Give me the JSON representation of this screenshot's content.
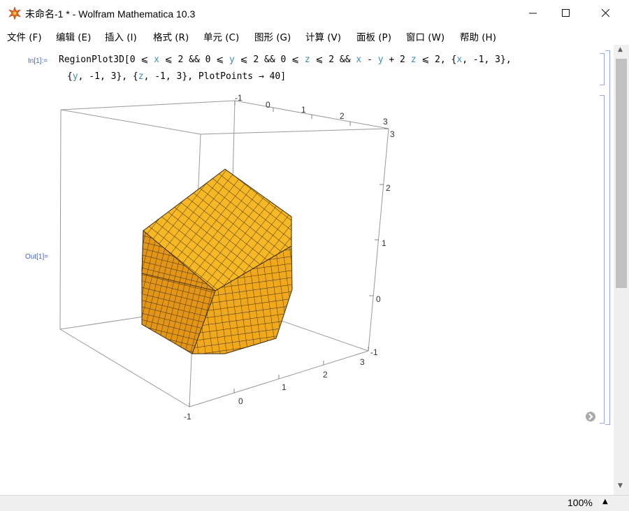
{
  "window": {
    "title": "未命名-1 * - Wolfram Mathematica 10.3",
    "minimize_glyph": "—",
    "maximize_glyph": "☐",
    "close_glyph": "✕"
  },
  "menu": [
    {
      "label": "文件 (F)"
    },
    {
      "label": "编辑 (E)"
    },
    {
      "label": "插入 (I)"
    },
    {
      "label": "格式 (R)"
    },
    {
      "label": "单元 (C)"
    },
    {
      "label": "图形 (G)"
    },
    {
      "label": "计算 (V)"
    },
    {
      "label": "面板 (P)"
    },
    {
      "label": "窗口 (W)"
    },
    {
      "label": "帮助 (H)"
    }
  ],
  "cells": {
    "input_label": "In[1]:=",
    "output_label": "Out[1]=",
    "line1": {
      "func": "RegionPlot3D",
      "open": "[0 ⩽ ",
      "x": "x",
      "c1": " ⩽ 2 && 0 ⩽ ",
      "y": "y",
      "c2": " ⩽ 2 && 0 ⩽ ",
      "z": "z",
      "c3": " ⩽ 2 && ",
      "x2": "x",
      "minus": " - ",
      "y2": "y",
      "plus": " + 2 ",
      "z2": "z",
      "c4": " ⩽ 2, {",
      "x3": "x",
      "c5": ", -1, 3},"
    },
    "line2": {
      "open": "{",
      "y": "y",
      "c1": ", -1, 3}, {",
      "z": "z",
      "c2": ", -1, 3}, PlotPoints → 40]"
    }
  },
  "plot_axes": {
    "x_ticks": [
      "-1",
      "0",
      "1",
      "2",
      "3"
    ],
    "x_ticks_top": [
      "-1",
      "0",
      "1",
      "2",
      "3"
    ],
    "z_ticks": [
      "-1",
      "0",
      "1",
      "2",
      "3"
    ]
  },
  "colors": {
    "surface_top": "#f6b824",
    "surface_front": "#f0a81c",
    "surface_side": "#d98a10",
    "mesh": "#3a2a10",
    "box": "#999999",
    "cell_bracket": "#9aa8e8",
    "label": "#4466bb",
    "variable": "#3b8fb2"
  },
  "status": {
    "zoom": "100%",
    "zoom_arrow": "▲"
  },
  "icons": {
    "app": "mathematica-spikey-icon",
    "scroll_up": "▲",
    "scroll_down": "▼"
  }
}
